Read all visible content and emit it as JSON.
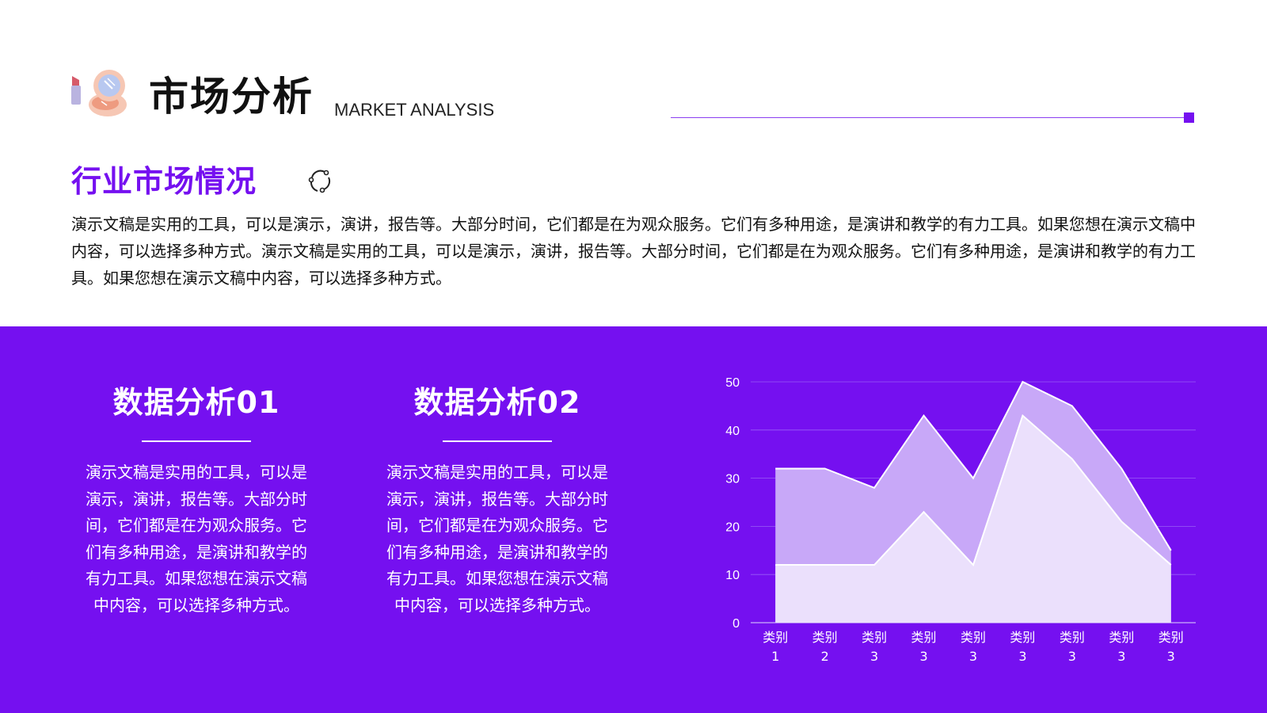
{
  "header": {
    "title_cn": "市场分析",
    "title_en": "MARKET ANALYSIS"
  },
  "section": {
    "title": "行业市场情况",
    "intro": "演示文稿是实用的工具，可以是演示，演讲，报告等。大部分时间，它们都是在为观众服务。它们有多种用途，是演讲和教学的有力工具。如果您想在演示文稿中内容，可以选择多种方式。演示文稿是实用的工具，可以是演示，演讲，报告等。大部分时间，它们都是在为观众服务。它们有多种用途，是演讲和教学的有力工具。如果您想在演示文稿中内容，可以选择多种方式。"
  },
  "columns": [
    {
      "title": "数据分析01",
      "body": "演示文稿是实用的工具，可以是演示，演讲，报告等。大部分时间，它们都是在为观众服务。它们有多种用途，是演讲和教学的有力工具。如果您想在演示文稿中内容，可以选择多种方式。"
    },
    {
      "title": "数据分析02",
      "body": "演示文稿是实用的工具，可以是演示，演讲，报告等。大部分时间，它们都是在为观众服务。它们有多种用途，是演讲和教学的有力工具。如果您想在演示文稿中内容，可以选择多种方式。"
    }
  ],
  "colors": {
    "accent": "#7510f0",
    "series_back": "#c8a8f8",
    "series_front": "#ebe0fc"
  },
  "icons": [
    "lipstick-compact-icon",
    "refresh-icon"
  ],
  "chart_data": {
    "type": "area",
    "categories": [
      [
        "类别",
        "1"
      ],
      [
        "类别",
        "2"
      ],
      [
        "类别",
        "3"
      ],
      [
        "类别",
        "3"
      ],
      [
        "类别",
        "3"
      ],
      [
        "类别",
        "3"
      ],
      [
        "类别",
        "3"
      ],
      [
        "类别",
        "3"
      ],
      [
        "类别",
        "3"
      ]
    ],
    "series": [
      {
        "values": [
          32,
          32,
          28,
          43,
          30,
          50,
          45,
          32,
          15
        ]
      },
      {
        "values": [
          12,
          12,
          12,
          23,
          12,
          43,
          34,
          21,
          12
        ]
      }
    ],
    "ylim": [
      0,
      50
    ],
    "yticks": [
      "0",
      "10",
      "20",
      "30",
      "40",
      "50"
    ],
    "grid": true,
    "title": "",
    "xlabel": "",
    "ylabel": ""
  }
}
